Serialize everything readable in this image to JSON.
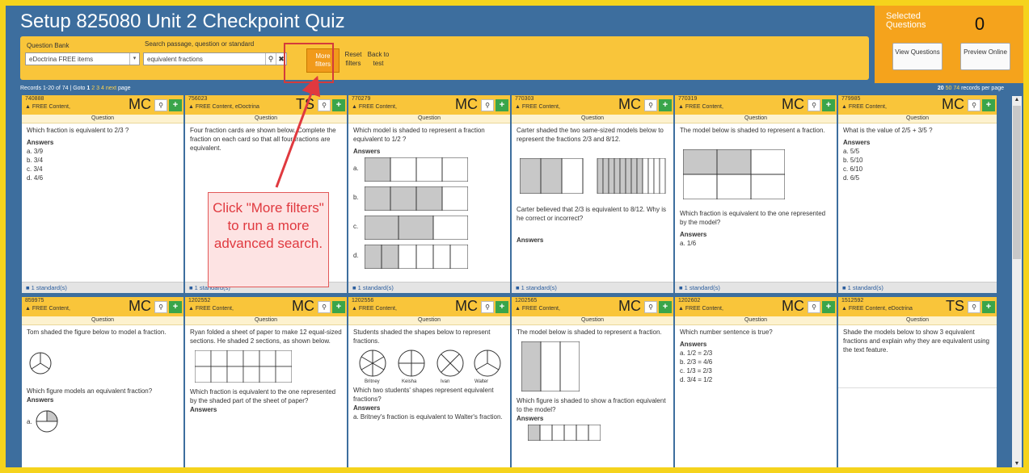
{
  "header": {
    "title": "Setup 825080 Unit 2 Checkpoint Quiz",
    "question_bank_label": "Question Bank",
    "question_bank_value": "eDoctrina FREE items",
    "search_label": "Search passage, question or standard",
    "search_value": "equivalent fractions",
    "search_icon": "magnifier",
    "clear_icon": "x",
    "more_filters_label": "More filters",
    "reset_filters_label": "Reset filters",
    "back_label": "Back to test"
  },
  "selected": {
    "label": "Selected Questions",
    "count": "0",
    "view_label": "View Questions",
    "preview_label": "Preview Online"
  },
  "records": {
    "text": "Records 1-20 of 74 | Goto",
    "current_page": "1",
    "pages": [
      "2",
      "3",
      "4"
    ],
    "next": "next",
    "page_word": "page",
    "per_page_current": "20",
    "per_page_options": [
      "50",
      "74"
    ],
    "per_page_text": "records per page"
  },
  "card_labels": {
    "question": "Question",
    "answers": "Answers",
    "standards": "1 standard(s)"
  },
  "cards": [
    {
      "id": "740888",
      "source": "FREE Content,",
      "type": "MC",
      "text": "Which fraction is equivalent to 2/3 ?",
      "answers": [
        "a. 3/9",
        "b. 3/4",
        "c. 3/4",
        "d. 4/6"
      ]
    },
    {
      "id": "756023",
      "source": "FREE Content, eDoctrina",
      "type": "TS",
      "text": "Four fraction cards are shown below. Complete the fraction on each card so that all four fractions are equivalent."
    },
    {
      "id": "770279",
      "source": "FREE Content,",
      "type": "MC",
      "text": "Which model is shaded to represent a fraction equivalent to 1/2 ?",
      "answers": [
        "a.",
        "b.",
        "c.",
        "d."
      ]
    },
    {
      "id": "770303",
      "source": "FREE Content,",
      "type": "MC",
      "text": "Carter shaded the two same-sized models below to represent the fractions 2/3 and 8/12.",
      "text2": "Carter believed that 2/3 is equivalent to 8/12. Why is he correct or incorrect?"
    },
    {
      "id": "770319",
      "source": "FREE Content,",
      "type": "MC",
      "text": "The model below is shaded to represent a fraction.",
      "text2": "Which fraction is equivalent to the one represented by the model?",
      "answers": [
        "a. 1/6"
      ]
    },
    {
      "id": "779985",
      "source": "FREE Content,",
      "type": "MC",
      "text": "What is the value of 2/5 + 3/5 ?",
      "answers": [
        "a. 5/5",
        "b. 5/10",
        "c. 6/10",
        "d. 6/5"
      ]
    },
    {
      "id": "859975",
      "source": "FREE Content,",
      "type": "MC",
      "text": "Tom shaded the figure below to model a fraction.",
      "text2": "Which figure models an equivalent fraction?",
      "answers": [
        "a."
      ]
    },
    {
      "id": "1202552",
      "source": "FREE Content,",
      "type": "MC",
      "text": "Ryan folded a sheet of paper to make 12 equal-sized sections. He shaded 2 sections, as shown below.",
      "text2": "Which fraction is equivalent to the one represented by the shaded part of the sheet of paper?"
    },
    {
      "id": "1202556",
      "source": "FREE Content,",
      "type": "MC",
      "text": "Students shaded the shapes below to represent fractions.",
      "names": [
        "Britney",
        "Keisha",
        "Ivan",
        "Walter"
      ],
      "text2": "Which two students' shapes represent equivalent fractions?",
      "answers": [
        "a. Britney's fraction is equivalent to Walter's fraction."
      ]
    },
    {
      "id": "1202565",
      "source": "FREE Content,",
      "type": "MC",
      "text": "The model below is shaded to represent a fraction.",
      "text2": "Which figure is shaded to show a fraction equivalent to the model?"
    },
    {
      "id": "1202602",
      "source": "FREE Content,",
      "type": "MC",
      "text": "Which number sentence is true?",
      "answers": [
        "a. 1/2 = 2/3",
        "b. 2/3 = 4/6",
        "c. 1/3 = 2/3",
        "d. 3/4 = 1/2"
      ]
    },
    {
      "id": "1512592",
      "source": "FREE Content, eDoctrina",
      "type": "TS",
      "text": "Shade the models below to show 3 equivalent fractions and explain why they are equivalent using the text feature."
    }
  ],
  "callout": "Click \"More filters\" to run a more advanced search.",
  "colors": {
    "frame": "#f5d31c",
    "app_bg": "#3d6e9e",
    "toolbar": "#f9c53a",
    "accent_orange": "#f19a1b",
    "callout_red": "#e0393f",
    "add_green": "#3aa54a"
  }
}
